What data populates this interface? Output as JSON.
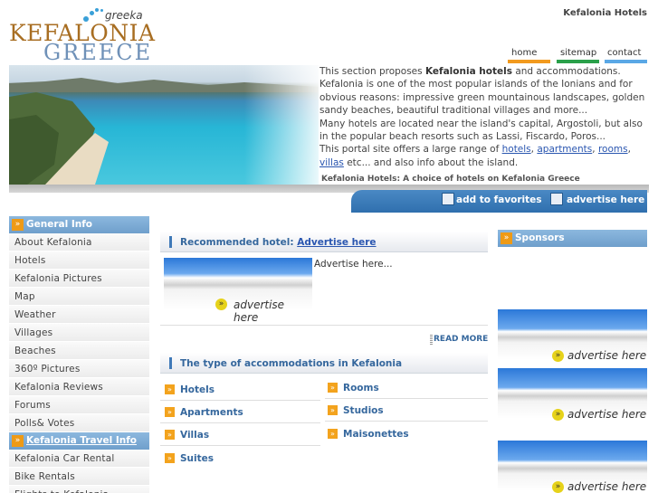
{
  "header": {
    "logo_brand": "greeka",
    "logo_line1": "KEFALONIA",
    "logo_line2": "GREECE",
    "page_heading": "Kefalonia Hotels",
    "nav": [
      {
        "label": "home",
        "color": "#f29a1e"
      },
      {
        "label": "sitemap",
        "color": "#2aa04a"
      },
      {
        "label": "contact",
        "color": "#5aa8e6"
      }
    ]
  },
  "hero": {
    "text": {
      "p1a": "This section proposes ",
      "p1b": "Kefalonia hotels",
      "p1c": " and accommodations. Kefalonia is one of the most popular islands of the Ionians and for obvious reasons: impressive green mountainous landscapes, golden sandy beaches, beautiful traditional villages and more...",
      "p2": "Many hotels are located near the island's capital, Argostoli, but also in the popular beach resorts such as Lassi, Fiscardo, Poros...",
      "p3a": "This portal site offers a large range of ",
      "p3_hotels": "hotels",
      "p3_apartments": "apartments",
      "p3_rooms": "rooms",
      "p3_villas": "villas",
      "p3b": " etc... and also info about the island.",
      "sep": ", "
    },
    "caption": "Kefalonia Hotels: A choice of hotels on Kefalonia Greece",
    "add_favorites": "add to favorites",
    "advertise_here": "advertise here"
  },
  "sidebar": {
    "general_info": "General Info",
    "items": [
      "About Kefalonia",
      "Hotels",
      "Kefalonia Pictures",
      "Map",
      "Weather",
      "Villages",
      "Beaches",
      "360º Pictures",
      "Kefalonia Reviews",
      "Forums",
      "Polls& Votes"
    ],
    "travel_info": "Kefalonia Travel Info",
    "travel_items": [
      "Kefalonia Car Rental",
      "Bike Rentals",
      "Flights to Kefalonia"
    ]
  },
  "main": {
    "recommended_label": "Recommended hotel: ",
    "recommended_link": "Advertise here",
    "ad_text": "Advertise here...",
    "ad_button": "advertise here",
    "read_more": "READ MORE",
    "types_heading": "The type of accommodations in Kefalonia",
    "types_left": [
      "Hotels",
      "Apartments",
      "Villas",
      "Suites"
    ],
    "types_right": [
      "Rooms",
      "Studios",
      "Maisonettes"
    ]
  },
  "right": {
    "sponsors": "Sponsors",
    "ad_button": "advertise here"
  }
}
